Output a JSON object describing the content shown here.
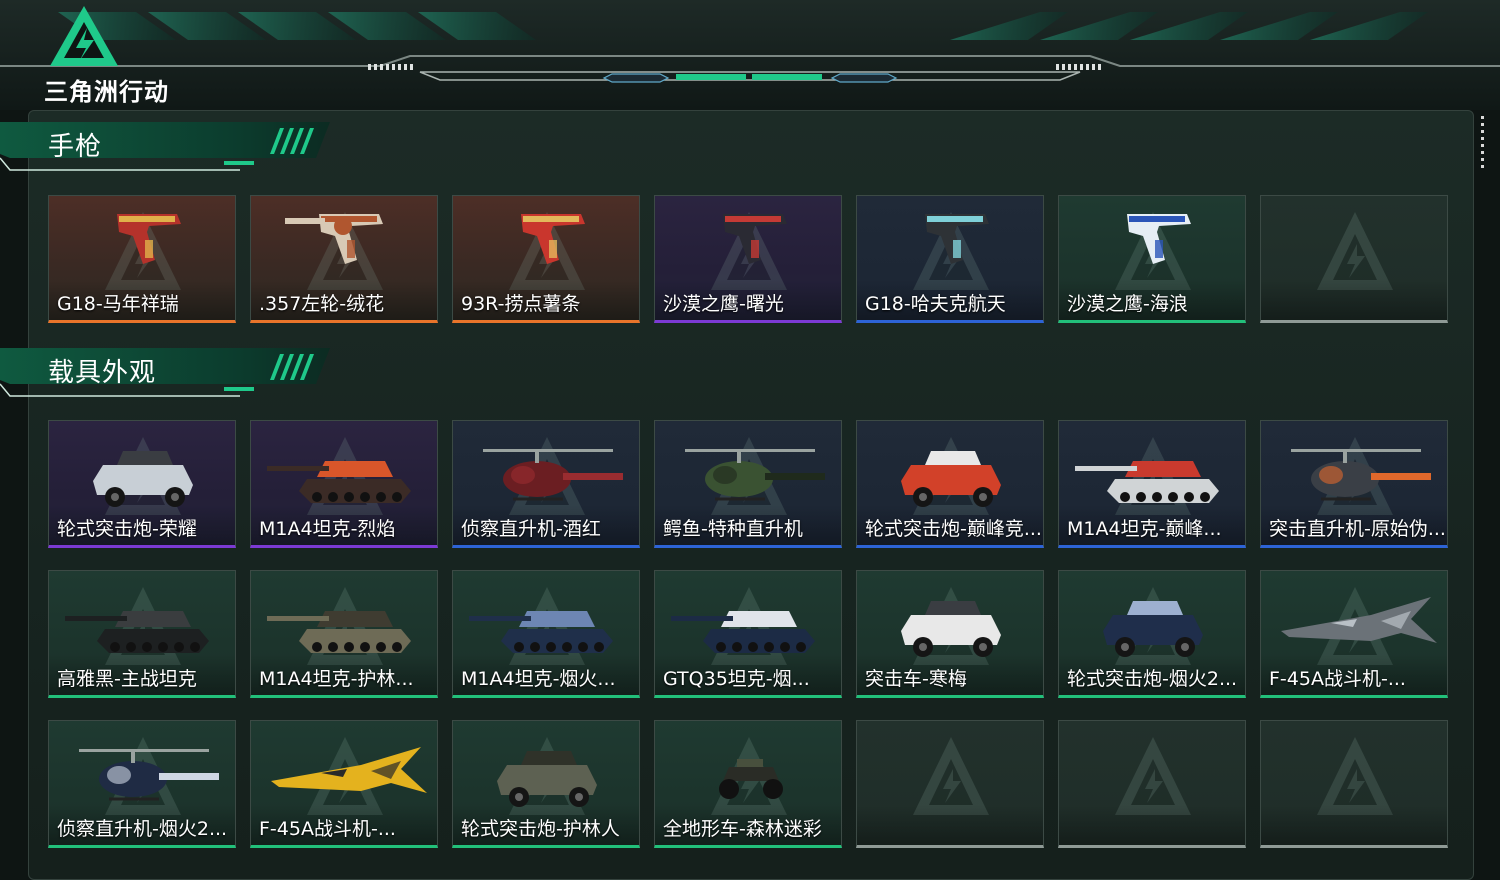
{
  "app": {
    "logo_text": "三角洲行动"
  },
  "colors": {
    "orange": "#e8742a",
    "purple": "#7c3ad4",
    "blue": "#2d63d6",
    "green": "#22c07a",
    "empty": "#8f9a96",
    "accent": "#1fc98a"
  },
  "sections": [
    {
      "title": "手枪",
      "items": [
        {
          "name": "G18-马年祥瑞",
          "rarity": "orange",
          "art": "pistol-red"
        },
        {
          "name": ".357左轮-绒花",
          "rarity": "orange",
          "art": "revolver"
        },
        {
          "name": "93R-捞点薯条",
          "rarity": "orange",
          "art": "pistol-redgold"
        },
        {
          "name": "沙漠之鹰-曙光",
          "rarity": "purple",
          "art": "deagle-dark"
        },
        {
          "name": "G18-哈夫克航天",
          "rarity": "blue",
          "art": "pistol-black"
        },
        {
          "name": "沙漠之鹰-海浪",
          "rarity": "green",
          "art": "deagle-blue"
        },
        {
          "name": "",
          "rarity": "empty",
          "art": "none"
        }
      ]
    },
    {
      "title": "载具外观",
      "items": [
        {
          "name": "轮式突击炮-荣耀",
          "rarity": "purple",
          "art": "wheeled-white"
        },
        {
          "name": "M1A4坦克-烈焰",
          "rarity": "purple",
          "art": "tank-flame"
        },
        {
          "name": "侦察直升机-酒红",
          "rarity": "blue",
          "art": "heli-scout-red"
        },
        {
          "name": "鳄鱼-特种直升机",
          "rarity": "blue",
          "art": "heli-attack-green"
        },
        {
          "name": "轮式突击炮-巅峰竞...",
          "rarity": "blue",
          "art": "wheeled-red"
        },
        {
          "name": "M1A4坦克-巅峰...",
          "rarity": "blue",
          "art": "tank-red"
        },
        {
          "name": "突击直升机-原始伪...",
          "rarity": "blue",
          "art": "heli-attack-orange"
        },
        {
          "name": "高雅黑-主战坦克",
          "rarity": "green",
          "art": "tank-black"
        },
        {
          "name": "M1A4坦克-护林...",
          "rarity": "green",
          "art": "tank-camo"
        },
        {
          "name": "M1A4坦克-烟火...",
          "rarity": "green",
          "art": "tank-navy"
        },
        {
          "name": "GTQ35坦克-烟...",
          "rarity": "green",
          "art": "tank-navy2"
        },
        {
          "name": "突击车-寒梅",
          "rarity": "green",
          "art": "truck-white"
        },
        {
          "name": "轮式突击炮-烟火2...",
          "rarity": "green",
          "art": "wheeled-navy"
        },
        {
          "name": "F-45A战斗机-...",
          "rarity": "green",
          "art": "jet-grey"
        },
        {
          "name": "侦察直升机-烟火2...",
          "rarity": "green",
          "art": "heli-scout-navy"
        },
        {
          "name": "F-45A战斗机-...",
          "rarity": "green",
          "art": "jet-yellow"
        },
        {
          "name": "轮式突击炮-护林人",
          "rarity": "green",
          "art": "wheeled-camo"
        },
        {
          "name": "全地形车-森林迷彩",
          "rarity": "green",
          "art": "atv"
        },
        {
          "name": "",
          "rarity": "empty",
          "art": "none"
        },
        {
          "name": "",
          "rarity": "empty",
          "art": "none"
        },
        {
          "name": "",
          "rarity": "empty",
          "art": "none"
        }
      ]
    }
  ]
}
